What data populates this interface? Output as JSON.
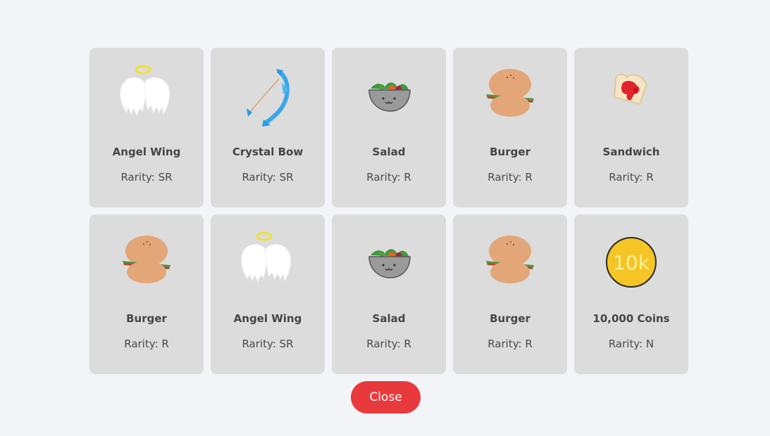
{
  "results": [
    {
      "name": "Angel Wing",
      "rarity_text": "Rarity: SR",
      "icon": "angel-wing-icon"
    },
    {
      "name": "Crystal Bow",
      "rarity_text": "Rarity: SR",
      "icon": "crystal-bow-icon"
    },
    {
      "name": "Salad",
      "rarity_text": "Rarity: R",
      "icon": "salad-icon"
    },
    {
      "name": "Burger",
      "rarity_text": "Rarity: R",
      "icon": "burger-icon"
    },
    {
      "name": "Sandwich",
      "rarity_text": "Rarity: R",
      "icon": "sandwich-icon"
    },
    {
      "name": "Burger",
      "rarity_text": "Rarity: R",
      "icon": "burger-icon"
    },
    {
      "name": "Angel Wing",
      "rarity_text": "Rarity: SR",
      "icon": "angel-wing-icon"
    },
    {
      "name": "Salad",
      "rarity_text": "Rarity: R",
      "icon": "salad-icon"
    },
    {
      "name": "Burger",
      "rarity_text": "Rarity: R",
      "icon": "burger-icon"
    },
    {
      "name": "10,000 Coins",
      "rarity_text": "Rarity: N",
      "icon": "coin-icon",
      "coin_label": "10k"
    }
  ],
  "close_button": {
    "label": "Close"
  },
  "colors": {
    "background": "#f3f4f8",
    "card": "#dcdcdc",
    "close_button": "#e8393d",
    "text": "#454545"
  }
}
